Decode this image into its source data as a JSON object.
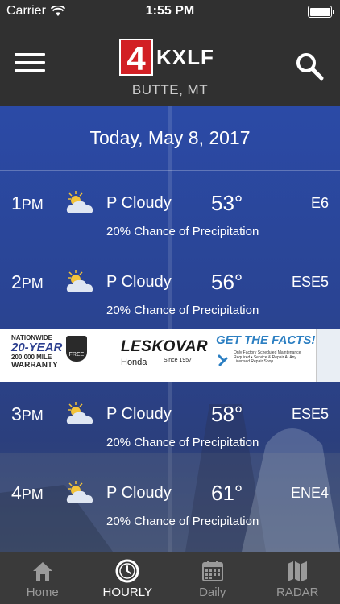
{
  "status_bar": {
    "carrier": "Carrier",
    "time": "1:55 PM"
  },
  "header": {
    "logo_number": "4",
    "logo_call": "KXLF",
    "location": "BUTTE, MT"
  },
  "date": "Today, May 8, 2017",
  "hours": [
    {
      "hour": "1",
      "ampm": "PM",
      "condition": "P Cloudy",
      "temp": "53°",
      "wind": "E6",
      "precip": "20% Chance of Precipitation",
      "icon": "partly-cloudy-icon"
    },
    {
      "hour": "2",
      "ampm": "PM",
      "condition": "P Cloudy",
      "temp": "56°",
      "wind": "ESE5",
      "precip": "20% Chance of Precipitation",
      "icon": "partly-cloudy-icon"
    },
    {
      "hour": "3",
      "ampm": "PM",
      "condition": "P Cloudy",
      "temp": "58°",
      "wind": "ESE5",
      "precip": "20% Chance of Precipitation",
      "icon": "partly-cloudy-icon"
    },
    {
      "hour": "4",
      "ampm": "PM",
      "condition": "P Cloudy",
      "temp": "61°",
      "wind": "ENE4",
      "precip": "20% Chance of Precipitation",
      "icon": "partly-cloudy-icon"
    }
  ],
  "ad": {
    "warranty_top": "NATIONWIDE",
    "warranty_big": "20-YEAR",
    "warranty_mid": "200,000 MILE",
    "warranty_bottom": "WARRANTY",
    "badge": "FREE",
    "dealer": "LESKOVAR",
    "make": "Honda",
    "since": "Since 1957",
    "headline": "GET THE FACTS!",
    "facts": "Only Factory Scheduled Maintenance Required  •  Service & Repair At Any Licensed Repair Shop"
  },
  "tabs": [
    {
      "label": "Home",
      "icon": "home-icon"
    },
    {
      "label": "HOURLY",
      "icon": "clock-icon"
    },
    {
      "label": "Daily",
      "icon": "calendar-icon"
    },
    {
      "label": "RADAR",
      "icon": "map-icon"
    }
  ],
  "active_tab": "HOURLY",
  "colors": {
    "brand_red": "#d21f24",
    "header_bg": "#303030",
    "tab_bg": "#3a3a3a",
    "ad_blue": "#2c7fc2"
  }
}
